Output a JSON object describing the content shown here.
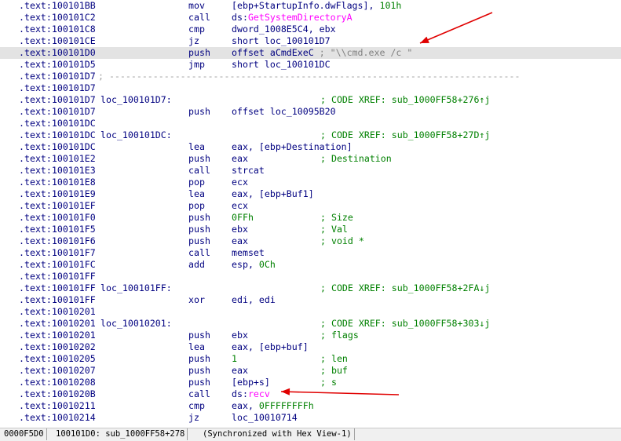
{
  "rows": [
    {
      "addr": ".text:100101BB",
      "mn": "mov",
      "op": [
        {
          "t": "[ebp+StartupInfo.dwFlags], "
        },
        {
          "t": "101h",
          "c": "num"
        }
      ]
    },
    {
      "addr": ".text:100101C2",
      "mn": "call",
      "op": [
        {
          "t": "ds:"
        },
        {
          "t": "GetSystemDirectoryA",
          "c": "api"
        }
      ]
    },
    {
      "addr": ".text:100101C8",
      "mn": "cmp",
      "op": [
        {
          "t": "dword_1008E5C4, ebx"
        }
      ]
    },
    {
      "addr": ".text:100101CE",
      "mn": "jz",
      "op": [
        {
          "t": "short loc_100101D7"
        }
      ]
    },
    {
      "addr": ".text:100101D0",
      "mn": "push",
      "op": [
        {
          "t": "offset aCmdExeC "
        },
        {
          "t": "; \"\\\\cmd.exe /c \"",
          "c": "strc"
        }
      ],
      "selected": true
    },
    {
      "addr": ".text:100101D5",
      "mn": "jmp",
      "op": [
        {
          "t": "short loc_100101DC"
        }
      ]
    },
    {
      "addr": ".text:100101D7",
      "sep": " ; ---------------------------------------------------------------------------"
    },
    {
      "addr": ".text:100101D7"
    },
    {
      "addr": ".text:100101D7",
      "label": "loc_100101D7:",
      "comment": "; CODE XREF: sub_1000FF58+276↑j"
    },
    {
      "addr": ".text:100101D7",
      "mn": "push",
      "op": [
        {
          "t": "offset loc_10095B20"
        }
      ]
    },
    {
      "addr": ".text:100101DC"
    },
    {
      "addr": ".text:100101DC",
      "label": "loc_100101DC:",
      "comment": "; CODE XREF: sub_1000FF58+27D↑j"
    },
    {
      "addr": ".text:100101DC",
      "mn": "lea",
      "op": [
        {
          "t": "eax, [ebp+Destination]"
        }
      ]
    },
    {
      "addr": ".text:100101E2",
      "mn": "push",
      "op": [
        {
          "t": "eax"
        }
      ],
      "comment": "; Destination"
    },
    {
      "addr": ".text:100101E3",
      "mn": "call",
      "op": [
        {
          "t": "strcat"
        }
      ]
    },
    {
      "addr": ".text:100101E8",
      "mn": "pop",
      "op": [
        {
          "t": "ecx"
        }
      ]
    },
    {
      "addr": ".text:100101E9",
      "mn": "lea",
      "op": [
        {
          "t": "eax, [ebp+Buf1]"
        }
      ]
    },
    {
      "addr": ".text:100101EF",
      "mn": "pop",
      "op": [
        {
          "t": "ecx"
        }
      ]
    },
    {
      "addr": ".text:100101F0",
      "mn": "push",
      "op": [
        {
          "t": "0FFh",
          "c": "num"
        }
      ],
      "comment": "; Size"
    },
    {
      "addr": ".text:100101F5",
      "mn": "push",
      "op": [
        {
          "t": "ebx"
        }
      ],
      "comment": "; Val"
    },
    {
      "addr": ".text:100101F6",
      "mn": "push",
      "op": [
        {
          "t": "eax"
        }
      ],
      "comment": "; void *"
    },
    {
      "addr": ".text:100101F7",
      "mn": "call",
      "op": [
        {
          "t": "memset"
        }
      ]
    },
    {
      "addr": ".text:100101FC",
      "mn": "add",
      "op": [
        {
          "t": "esp, "
        },
        {
          "t": "0Ch",
          "c": "num"
        }
      ]
    },
    {
      "addr": ".text:100101FF"
    },
    {
      "addr": ".text:100101FF",
      "label": "loc_100101FF:",
      "comment": "; CODE XREF: sub_1000FF58+2FA↓j"
    },
    {
      "addr": ".text:100101FF",
      "mn": "xor",
      "op": [
        {
          "t": "edi, edi"
        }
      ]
    },
    {
      "addr": ".text:10010201"
    },
    {
      "addr": ".text:10010201",
      "label": "loc_10010201:",
      "comment": "; CODE XREF: sub_1000FF58+303↓j"
    },
    {
      "addr": ".text:10010201",
      "mn": "push",
      "op": [
        {
          "t": "ebx"
        }
      ],
      "comment": "; flags"
    },
    {
      "addr": ".text:10010202",
      "mn": "lea",
      "op": [
        {
          "t": "eax, [ebp+buf]"
        }
      ]
    },
    {
      "addr": ".text:10010205",
      "mn": "push",
      "op": [
        {
          "t": "1",
          "c": "num"
        }
      ],
      "comment": "; len"
    },
    {
      "addr": ".text:10010207",
      "mn": "push",
      "op": [
        {
          "t": "eax"
        }
      ],
      "comment": "; buf"
    },
    {
      "addr": ".text:10010208",
      "mn": "push",
      "op": [
        {
          "t": "[ebp+s]"
        }
      ],
      "comment": "; s"
    },
    {
      "addr": ".text:1001020B",
      "mn": "call",
      "op": [
        {
          "t": "ds:"
        },
        {
          "t": "recv",
          "c": "api"
        }
      ]
    },
    {
      "addr": ".text:10010211",
      "mn": "cmp",
      "op": [
        {
          "t": "eax, "
        },
        {
          "t": "0FFFFFFFFh",
          "c": "num"
        }
      ]
    },
    {
      "addr": ".text:10010214",
      "mn": "jz",
      "op": [
        {
          "t": "loc_10010714"
        }
      ]
    }
  ],
  "status": {
    "offset": "0000F5D0",
    "location": "100101D0: sub_1000FF58+278",
    "sync": "(Synchronized with Hex View-1)"
  },
  "colors": {
    "text": "#000080",
    "comment": "#008000",
    "api": "#ff00ff",
    "selected_row": "#e3e3e3",
    "arrow": "#e00000"
  }
}
